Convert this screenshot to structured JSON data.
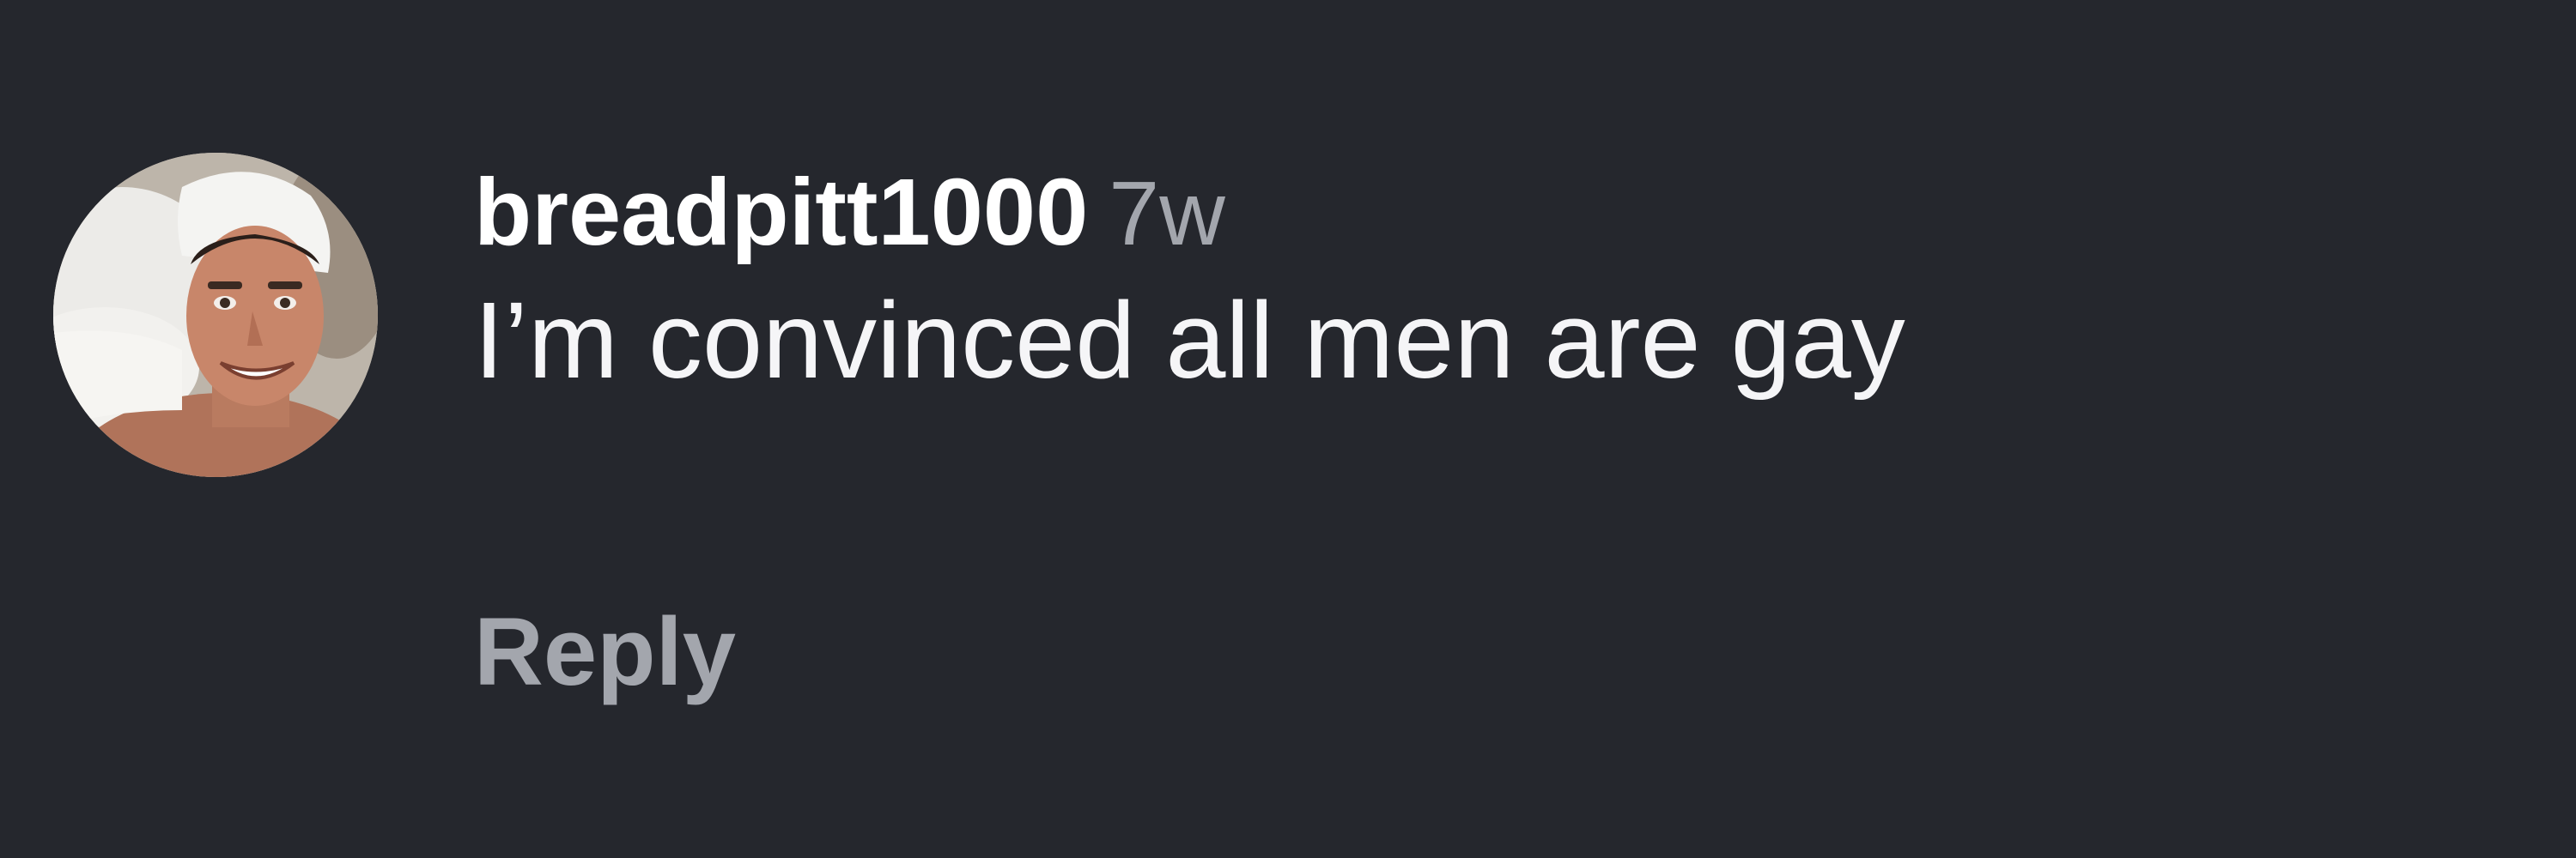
{
  "comment": {
    "avatar_icon": "profile-photo",
    "username": "breadpitt1000",
    "timestamp": "7w",
    "text": "I’m convinced all men are gay",
    "reply_label": "Reply"
  },
  "colors": {
    "background": "#25272d",
    "username": "#ffffff",
    "timestamp": "#a3a6ad",
    "text": "#f5f5f7",
    "reply": "#a3a6ad"
  }
}
